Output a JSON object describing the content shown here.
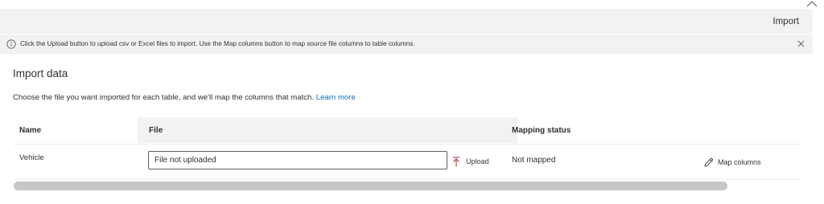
{
  "command_bar": {
    "import_label": "Import"
  },
  "banner": {
    "icon": "info-icon",
    "text": "Click the Upload button to upload csv or Excel files to import. Use the Map columns button to map source file columns to table columns."
  },
  "main": {
    "heading": "Import data",
    "description": "Choose the file you want imported for each table, and we'll map the columns that match.",
    "learn_more": "Learn more"
  },
  "table": {
    "columns": {
      "name": "Name",
      "file": "File",
      "mapping_status": "Mapping status"
    },
    "rows": [
      {
        "name": "Vehicle",
        "file_value": "File not uploaded",
        "upload_label": "Upload",
        "mapping_status": "Not mapped",
        "map_label": "Map columns"
      }
    ]
  },
  "colors": {
    "link": "#0f6cbd",
    "upload_icon": "#a4262c"
  }
}
